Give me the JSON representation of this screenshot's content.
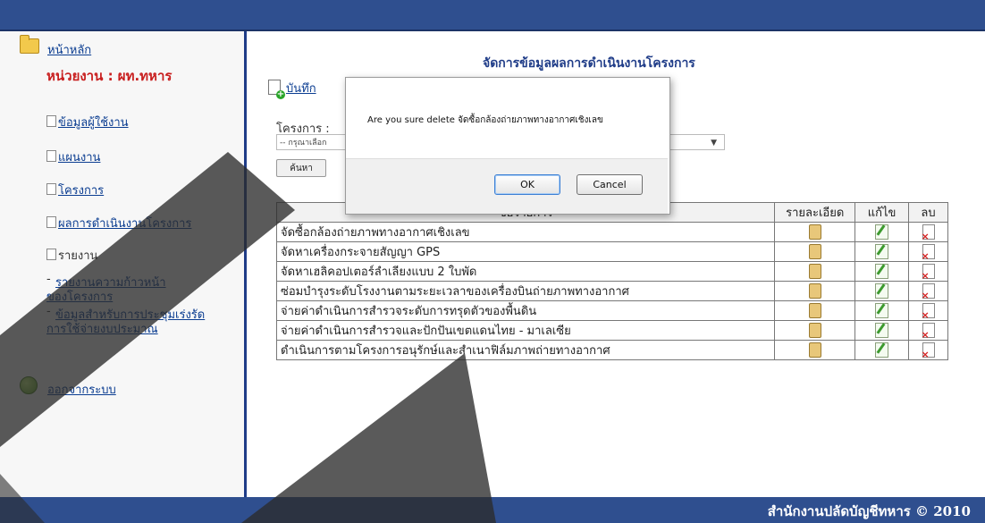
{
  "sidebar": {
    "home_link": "หน้าหลัก",
    "unit": "หน่วยงาน : ผท.ทหาร",
    "items": [
      {
        "label": "ข้อมูลผู้ใช้งาน"
      },
      {
        "label": "แผนงาน"
      },
      {
        "label": "โครงการ"
      },
      {
        "label": "ผลการดำเนินงานโครงการ"
      }
    ],
    "report_label": "รายงาน",
    "report_links": [
      {
        "line1": "รายงานความก้าวหน้า",
        "line2": "ของโครงการ"
      },
      {
        "line1": "ข้อมูลสำหรับการประชุมเร่งรัด",
        "line2": "การใช้จ่ายงบประมาณ"
      }
    ],
    "logout": "ออกจากระบบ"
  },
  "main": {
    "title": "จัดการข้อมูลผลการดำเนินงานโครงการ",
    "record_link": "บันทึก",
    "project_label": "โครงการ :",
    "project_select_value": "-- กรุณาเลือก",
    "search_button": "ค้นหา"
  },
  "table": {
    "headers": [
      "ชื่อรายการ",
      "รายละเอียด",
      "แก้ไข",
      "ลบ"
    ],
    "rows": [
      "จัดซื้อกล้องถ่ายภาพทางอากาศเชิงเลข",
      "จัดหาเครื่องกระจายสัญญา GPS",
      "จัดหาเฮลิคอปเตอร์ลำเลียงแบบ 2 ใบพัด",
      "ซ่อมบำรุงระดับโรงงานตามระยะเวลาของเครื่องบินถ่ายภาพทางอากาศ",
      "จ่ายค่าดำเนินการสำรวจระดับการทรุดตัวของพื้นดิน",
      "จ่ายค่าดำเนินการสำรวจและปักปันเขตแดนไทย - มาเลเซีย",
      "ดำเนินการตามโครงการอนุรักษ์และสำเนาฟิล์มภาพถ่ายทางอากาศ"
    ]
  },
  "dialog": {
    "message": "Are you sure delete จัดซื้อกล้องถ่ายภาพทางอากาศเชิงเลข",
    "ok": "OK",
    "cancel": "Cancel"
  },
  "footer": {
    "text": "สำนักงานปลัดบัญชีทหาร © 2010"
  },
  "colors": {
    "header_bar": "#2f4f8f",
    "link": "#0b3d91",
    "unit_text": "#c81e1e"
  }
}
